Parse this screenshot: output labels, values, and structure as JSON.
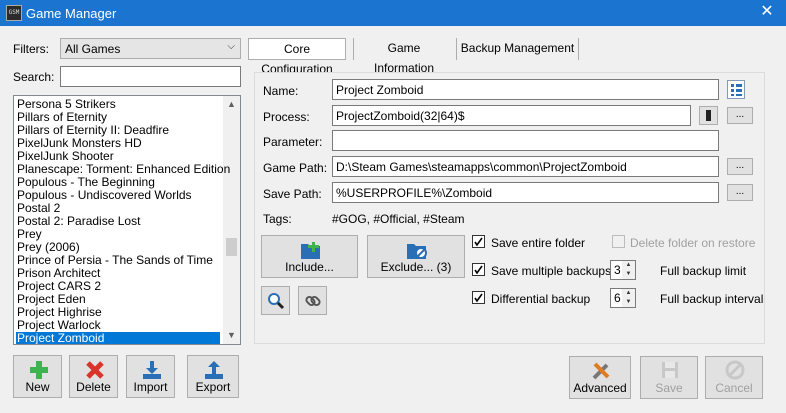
{
  "window": {
    "title": "Game Manager",
    "icon_text": "GSM",
    "close_glyph": "✕"
  },
  "filters": {
    "label": "Filters:",
    "selected": "All Games"
  },
  "search": {
    "label": "Search:",
    "value": ""
  },
  "games": [
    "Persona 5 Strikers",
    "Pillars of Eternity",
    "Pillars of Eternity II: Deadfire",
    "PixelJunk Monsters HD",
    "PixelJunk Shooter",
    "Planescape: Torment: Enhanced Edition",
    "Populous - The Beginning",
    "Populous - Undiscovered Worlds",
    "Postal 2",
    "Postal 2: Paradise Lost",
    "Prey",
    "Prey (2006)",
    "Prince of Persia - The Sands of Time",
    "Prison Architect",
    "Project CARS 2",
    "Project Eden",
    "Project Highrise",
    "Project Warlock",
    "Project Zomboid"
  ],
  "selected_game": "Project Zomboid",
  "list_buttons": {
    "new": "New",
    "delete": "Delete",
    "import": "Import",
    "export": "Export"
  },
  "tabs": [
    "Core Configuration",
    "Game Information",
    "Backup Management"
  ],
  "active_tab": "Core Configuration",
  "form": {
    "name_label": "Name:",
    "name_value": "Project Zomboid",
    "process_label": "Process:",
    "process_value": "ProjectZomboid(32|64)$",
    "parameter_label": "Parameter:",
    "parameter_value": "",
    "game_path_label": "Game Path:",
    "game_path_value": "D:\\Steam Games\\steamapps\\common\\ProjectZomboid",
    "save_path_label": "Save Path:",
    "save_path_value": "%USERPROFILE%\\Zomboid",
    "tags_label": "Tags:",
    "tags_value": "#GOG, #Official, #Steam",
    "browse_label": "..."
  },
  "include_button": "Include...",
  "exclude_button": "Exclude... (3)",
  "options": {
    "save_entire_folder": {
      "label": "Save entire folder",
      "checked": true
    },
    "delete_folder_on_restore": {
      "label": "Delete folder on restore",
      "checked": false,
      "disabled": true
    },
    "save_multiple_backups": {
      "label": "Save multiple backups",
      "checked": true
    },
    "full_backup_limit": {
      "label": "Full backup limit",
      "value": "3"
    },
    "differential_backup": {
      "label": "Differential backup",
      "checked": true
    },
    "full_backup_interval": {
      "label": "Full backup interval",
      "value": "6"
    }
  },
  "bottom_buttons": {
    "advanced": "Advanced",
    "save": "Save",
    "cancel": "Cancel"
  },
  "colors": {
    "titlebar": "#1b75d0",
    "selection": "#0078d7",
    "new_green": "#3fb34f",
    "delete_red": "#d9342b"
  }
}
